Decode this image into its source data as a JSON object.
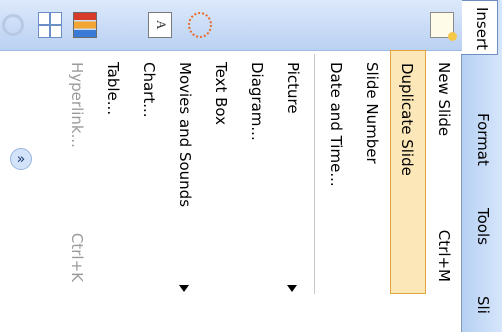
{
  "menubar": {
    "items": [
      {
        "label": "Insert",
        "active": true
      },
      {
        "label": "Format"
      },
      {
        "label": "Tools"
      },
      {
        "label": "Sli"
      }
    ]
  },
  "menu": {
    "items": [
      {
        "label": "New Slide",
        "shortcut": "Ctrl+M",
        "icon": "new-slide-icon"
      },
      {
        "label": "Duplicate Slide",
        "highlighted": true
      },
      {
        "label": "Slide Number"
      },
      {
        "label": "Date and Time..."
      },
      {
        "label": "Picture",
        "submenu": true
      },
      {
        "label": "Diagram...",
        "icon": "diagram-icon"
      },
      {
        "label": "Text Box",
        "icon": "text-box-icon"
      },
      {
        "label": "Movies and Sounds",
        "submenu": true
      },
      {
        "label": "Chart...",
        "icon": "chart-icon"
      },
      {
        "label": "Table...",
        "icon": "table-icon"
      },
      {
        "label": "Hyperlink...",
        "shortcut": "Ctrl+K",
        "icon": "hyperlink-icon",
        "disabled": true
      }
    ],
    "expand_glyph": "«"
  }
}
